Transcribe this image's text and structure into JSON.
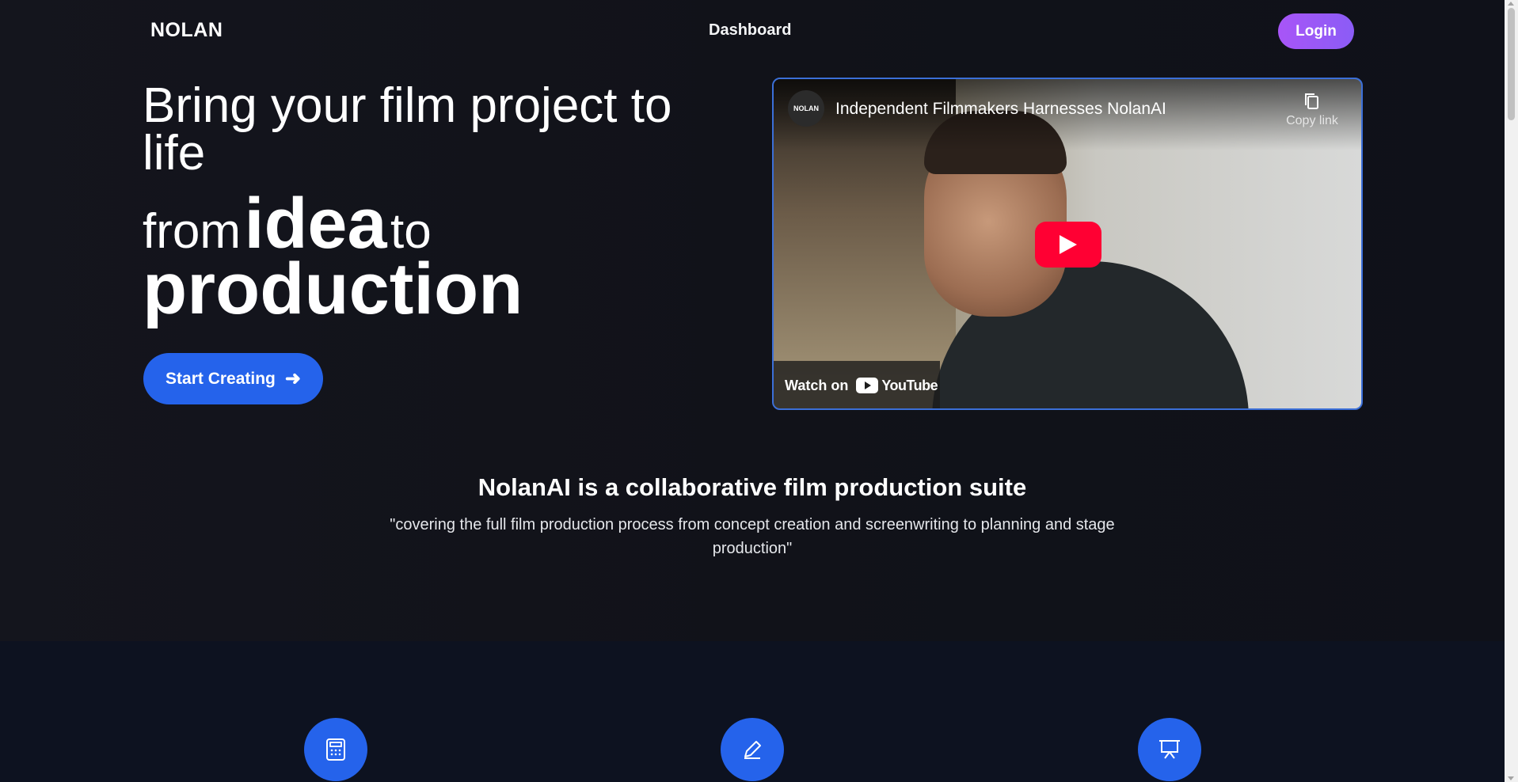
{
  "header": {
    "logo": "NOLAN",
    "nav_dashboard": "Dashboard",
    "login_label": "Login"
  },
  "hero": {
    "line1": "Bring your film project to life",
    "line2_from": "from",
    "line2_idea": "idea",
    "line2_to": "to",
    "line3": "production",
    "cta_label": "Start Creating",
    "cta_arrow": "➜"
  },
  "video": {
    "channel_logo": "NOLAN",
    "title": "Independent Filmmakers Harnesses NolanAI",
    "copy_link_label": "Copy link",
    "watch_on_label": "Watch on",
    "youtube_label": "YouTube"
  },
  "info": {
    "title": "NolanAI is a collaborative film production suite",
    "description": "\"covering the full film production process from concept creation and screenwriting to planning and stage production\""
  },
  "features": [
    {
      "icon": "calculator-icon"
    },
    {
      "icon": "pencil-icon"
    },
    {
      "icon": "presentation-icon"
    }
  ],
  "colors": {
    "background": "#12141c",
    "primary_blue": "#2563eb",
    "login_purple": "#a855f7",
    "youtube_red": "#ff0033"
  }
}
